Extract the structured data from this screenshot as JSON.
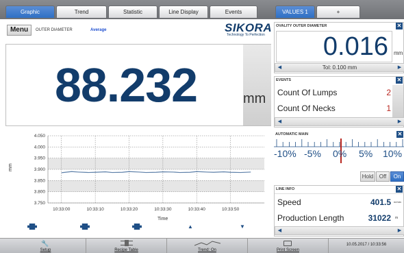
{
  "tabs": [
    {
      "label": "Graphic",
      "active": true
    },
    {
      "label": "Trend",
      "active": false
    },
    {
      "label": "Statistic",
      "active": false
    },
    {
      "label": "Line Display",
      "active": false
    },
    {
      "label": "Events",
      "active": false
    },
    {
      "label": "VALUES 1",
      "active": true
    },
    {
      "label": "+",
      "active": false
    }
  ],
  "header": {
    "menu_label": "Menu",
    "measure_label": "OUTER DIAMETER",
    "mode_label": "Average",
    "brand": "SIKORA",
    "brand_tagline": "Technology To Perfection"
  },
  "main_value": {
    "value": "88.232",
    "unit": "mm"
  },
  "chart_data": {
    "type": "line",
    "title": "",
    "xlabel": "Time",
    "ylabel": "mm",
    "ylim": [
      3.75,
      4.05
    ],
    "y_ticks": [
      "3.750",
      "3.800",
      "3.850",
      "3.900",
      "3.950",
      "4.000",
      "4.050"
    ],
    "x_ticks": [
      "10:33:00",
      "10:33:10",
      "10:33:20",
      "10:33:30",
      "10:33:40",
      "10:33:50"
    ],
    "series": [
      {
        "x": [
          0,
          3,
          5,
          8,
          10,
          13,
          15,
          18,
          20,
          23,
          25,
          28,
          30,
          33,
          35,
          38,
          40,
          43,
          45,
          48,
          50,
          53,
          56
        ],
        "values": [
          3.885,
          3.89,
          3.888,
          3.886,
          3.887,
          3.889,
          3.886,
          3.887,
          3.89,
          3.888,
          3.886,
          3.887,
          3.889,
          3.888,
          3.886,
          3.887,
          3.89,
          3.888,
          3.887,
          3.889,
          3.887,
          3.886,
          3.888
        ]
      }
    ],
    "bands": [
      [
        3.8,
        3.85
      ],
      [
        3.9,
        3.95
      ]
    ],
    "grid": true
  },
  "ovality": {
    "title": "OVALITY OUTER DIAMETER",
    "value": "0.016",
    "unit": "mm",
    "tolerance": "Tol: 0.100 mm"
  },
  "events": {
    "title": "EVENTS",
    "rows": [
      {
        "label": "Count Of Lumps",
        "value": "2"
      },
      {
        "label": "Count Of Necks",
        "value": "1"
      }
    ]
  },
  "automatic_main": {
    "title": "AUTOMATIC MAIN",
    "scale_labels": [
      "-10%",
      "-5%",
      "0%",
      "5%",
      "10%"
    ],
    "indicator_percent": 0,
    "buttons": [
      {
        "label": "Hold",
        "active": false
      },
      {
        "label": "Off",
        "active": false
      },
      {
        "label": "On",
        "active": true
      }
    ]
  },
  "line_info": {
    "title": "LINE INFO",
    "rows": [
      {
        "label": "Speed",
        "value": "401.5",
        "unit": "m/min"
      },
      {
        "label": "Production Length",
        "value": "31022",
        "unit": "m"
      }
    ]
  },
  "bottom_toolbar": {
    "buttons": [
      {
        "label": "Setup",
        "icon": "wrench-icon"
      },
      {
        "label": "Recipe Table",
        "icon": "table-icon"
      },
      {
        "label": "Trend: On",
        "icon": "trend-icon"
      },
      {
        "label": "Print Screen",
        "icon": "printer-icon"
      }
    ],
    "datetime": "10.05.2017 / 10:33:56"
  },
  "colors": {
    "accent": "#2e6fc4",
    "value_dark_blue": "#123c6b",
    "alert_red": "#b8261f"
  }
}
